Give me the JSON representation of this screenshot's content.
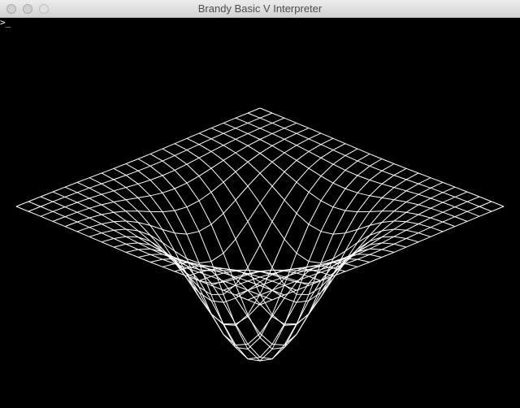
{
  "window": {
    "title": "Brandy Basic V Interpreter",
    "controls": [
      "close",
      "minimize",
      "zoom"
    ]
  },
  "console": {
    "prompt": ">",
    "cursor": "_",
    "background": "#000000",
    "foreground": "#ffffff"
  },
  "graphics": {
    "description_icon": "wireframe-surface",
    "line_color": "#ffffff",
    "grid_lines": 21
  }
}
